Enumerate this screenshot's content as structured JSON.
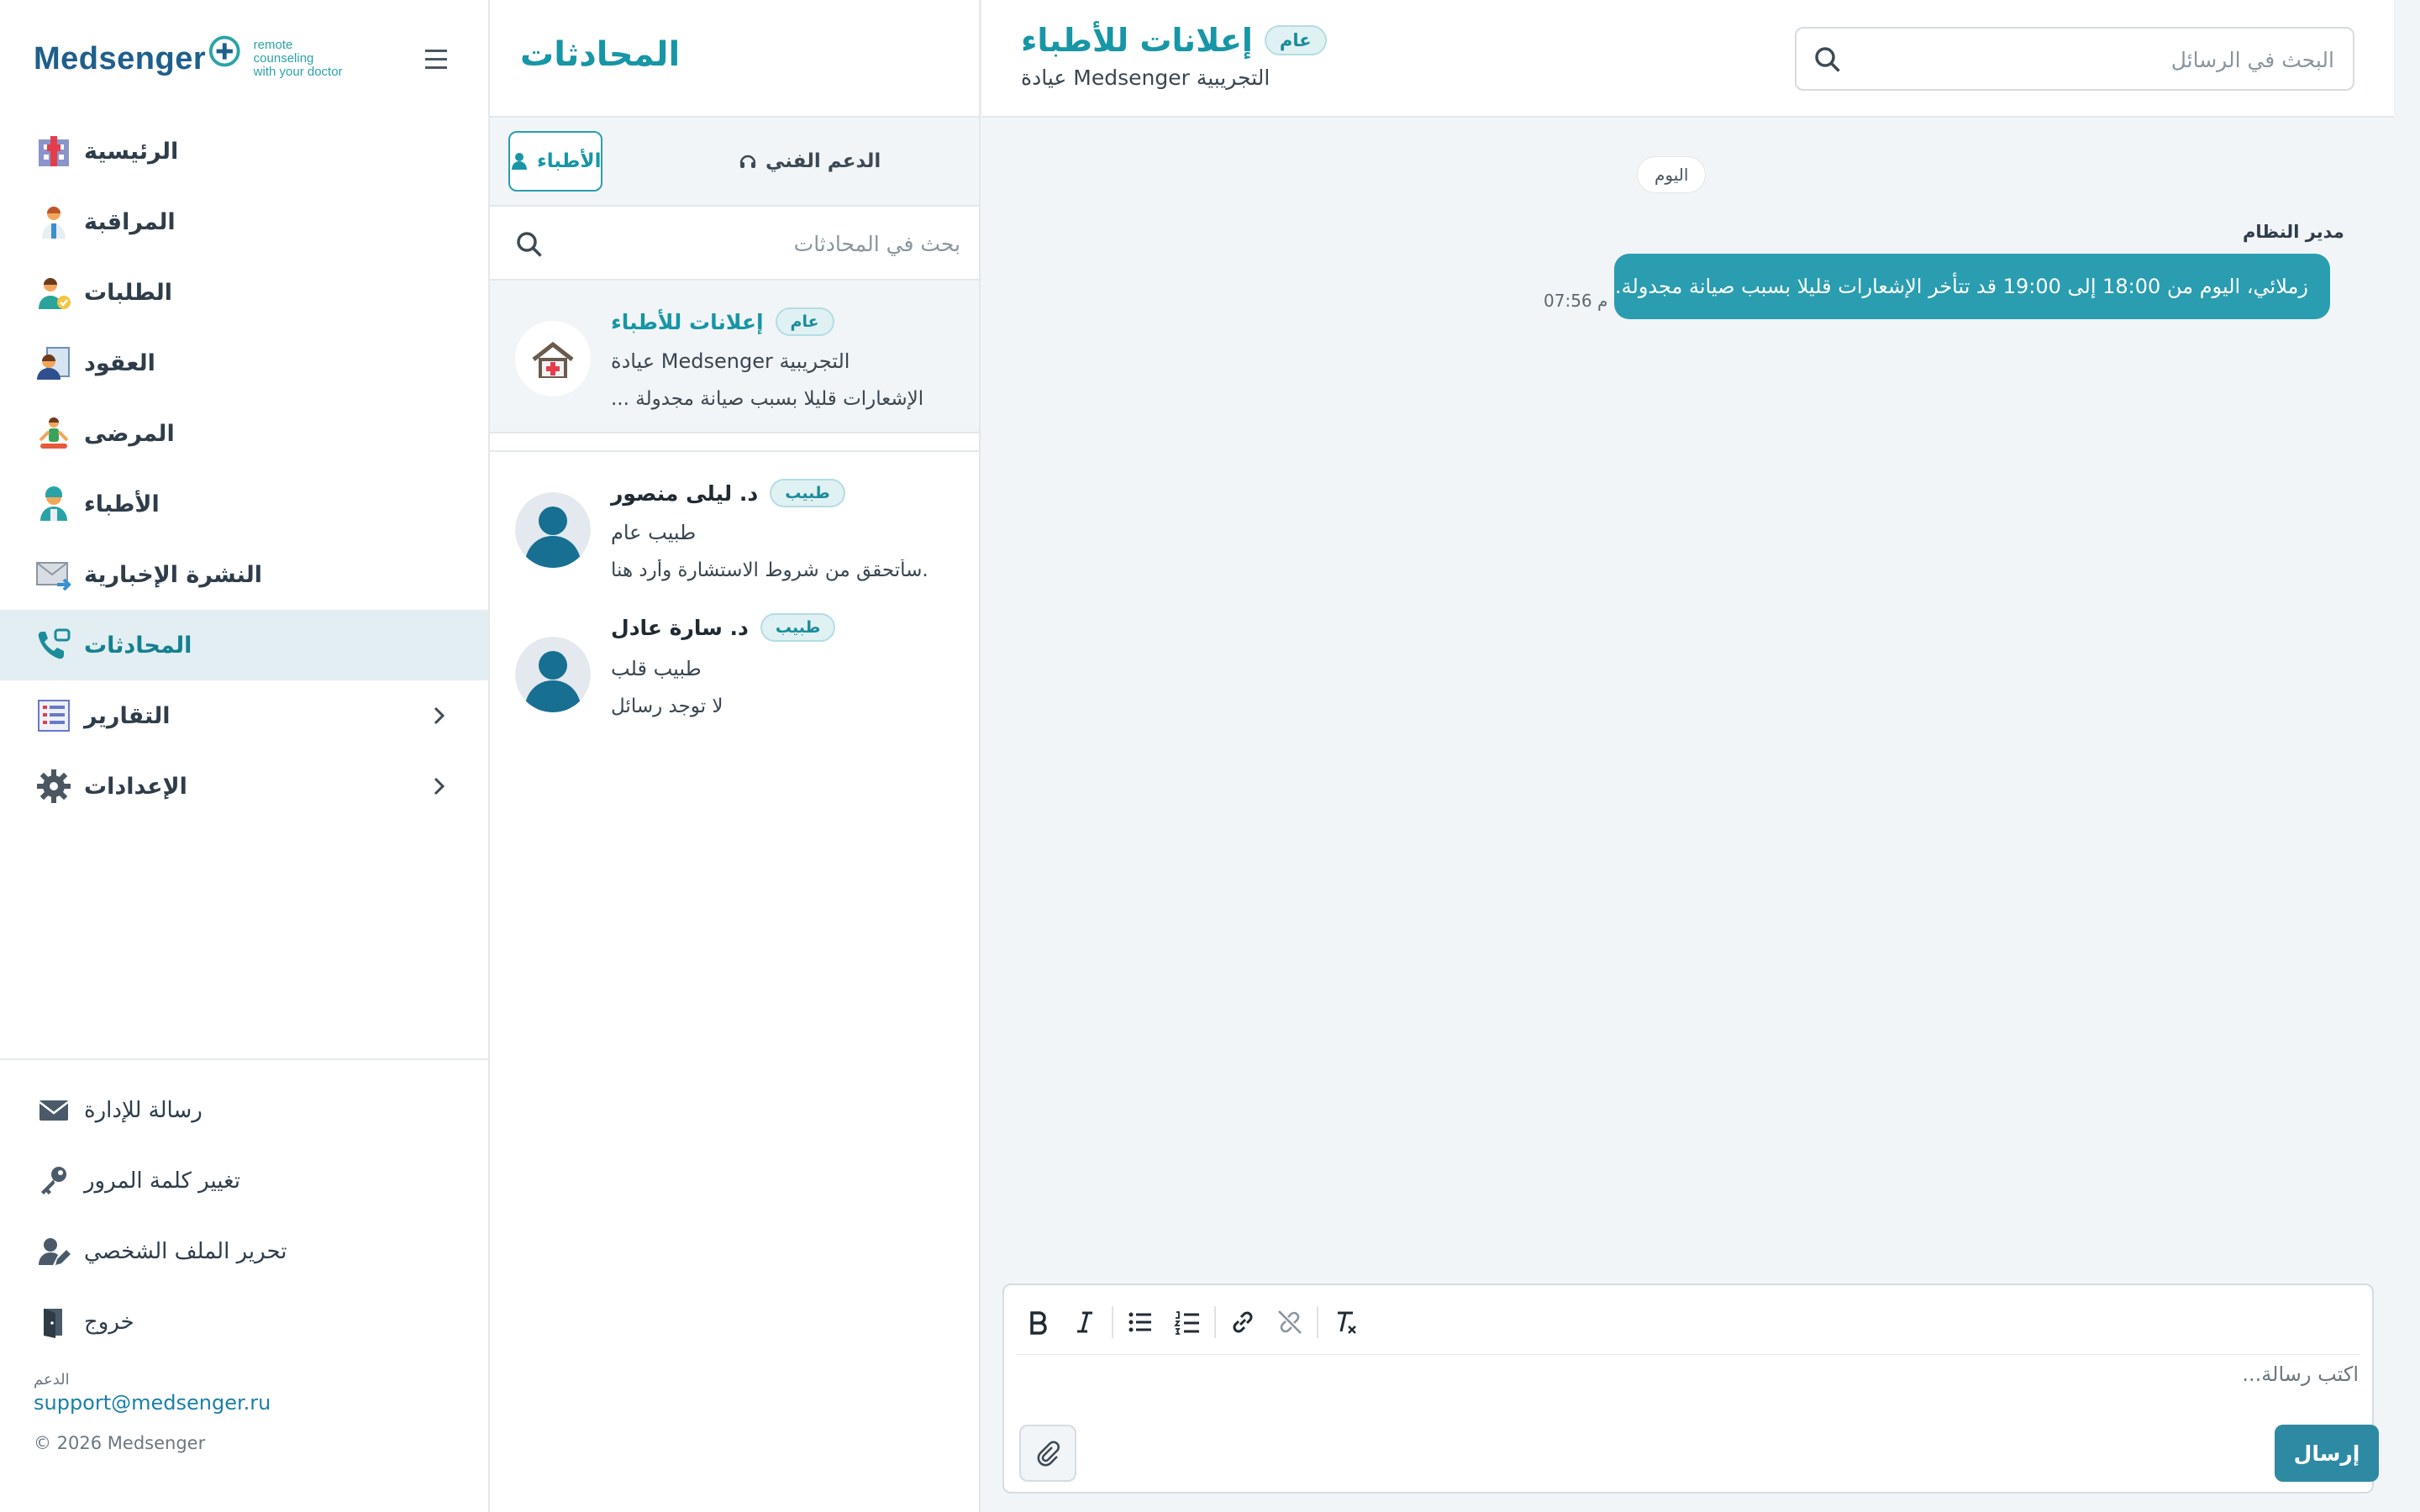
{
  "brand": {
    "name": "Medsenger",
    "tagline_line1": "remote counseling",
    "tagline_line2": "with your doctor",
    "color": "#1f5f8c",
    "accent": "#2aa3a8"
  },
  "sidebar": {
    "menu_icon": "hamburger-icon",
    "items": [
      {
        "label": "الرئيسية",
        "icon": "hospital-icon",
        "active": false
      },
      {
        "label": "المراقبة",
        "icon": "monitoring-doctor-icon",
        "active": false
      },
      {
        "label": "الطلبات",
        "icon": "requests-user-icon",
        "active": false
      },
      {
        "label": "العقود",
        "icon": "contracts-icon",
        "active": false
      },
      {
        "label": "المرضى",
        "icon": "patients-icon",
        "active": false
      },
      {
        "label": "الأطباء",
        "icon": "doctors-icon",
        "active": false
      },
      {
        "label": "النشرة الإخبارية",
        "icon": "newsletter-icon",
        "active": false
      },
      {
        "label": "المحادثات",
        "icon": "chat-phone-icon",
        "active": true
      },
      {
        "label": "التقارير",
        "icon": "reports-icon",
        "active": false,
        "expandable": true
      },
      {
        "label": "الإعدادات",
        "icon": "settings-gear-icon",
        "active": false,
        "expandable": true
      }
    ],
    "bottom": [
      {
        "label": "رسالة للإدارة",
        "icon": "mail-icon"
      },
      {
        "label": "تغيير كلمة المرور",
        "icon": "key-icon"
      },
      {
        "label": "تحرير الملف الشخصي",
        "icon": "edit-profile-icon"
      },
      {
        "label": "خروج",
        "icon": "logout-door-icon"
      }
    ],
    "support_caption": "الدعم",
    "support_email": "support@medsenger.ru",
    "copyright": "© 2026 Medsenger"
  },
  "chatlist": {
    "title": "المحادثات",
    "tabs": [
      {
        "label": "الدعم الفني",
        "icon": "headset-icon",
        "active": false
      },
      {
        "label": "الأطباء",
        "icon": "doctor-person-icon",
        "active": true
      }
    ],
    "search_placeholder": "بحث في المحادثات",
    "chats": [
      {
        "name": "إعلانات للأطباء",
        "badge": "عام",
        "subtitle": "عيادة Medsenger التجريبية",
        "preview": "... الإشعارات قليلا بسبب صيانة مجدولة",
        "selected": true,
        "avatar": "clinic-icon"
      },
      {
        "name": "د. ليلى منصور",
        "badge": "طبيب",
        "subtitle": "طبيب عام",
        "preview": "سأتحقق من شروط الاستشارة وأرد هنا.",
        "selected": false,
        "avatar": "user-avatar-icon"
      },
      {
        "name": "د. سارة عادل",
        "badge": "طبيب",
        "subtitle": "طبيب قلب",
        "preview": "لا توجد رسائل",
        "selected": false,
        "avatar": "user-avatar-icon"
      }
    ]
  },
  "conversation": {
    "title": "إعلانات للأطباء",
    "badge": "عام",
    "subtitle": "عيادة Medsenger التجريبية",
    "search_placeholder": "البحث في الرسائل",
    "day_label": "اليوم",
    "messages": [
      {
        "sender": "مدير النظام",
        "text": "زملائي، اليوم من 18:00 إلى 19:00 قد تتأخر الإشعارات قليلا بسبب صيانة مجدولة.",
        "time": "07:56 م"
      }
    ],
    "composer": {
      "placeholder": "اكتب رسالة...",
      "send_label": "إرسال",
      "toolbar": [
        "bold-icon",
        "italic-icon",
        "bullet-list-icon",
        "numbered-list-icon",
        "link-icon",
        "unlink-icon",
        "clear-format-icon"
      ]
    }
  },
  "colors": {
    "teal": "#2a9db0",
    "teal_dark": "#1796a6",
    "send_button": "#2e8aa3",
    "active_nav_bg": "#e2eef2"
  }
}
